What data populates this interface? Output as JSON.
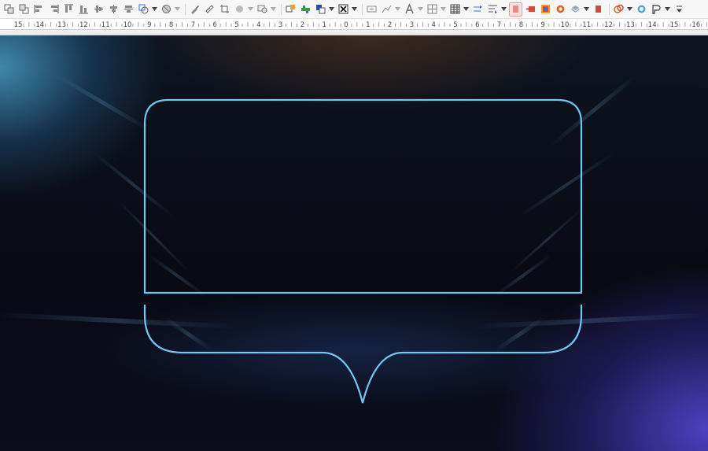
{
  "toolbar": {
    "icons": [
      "bring-forward-icon",
      "send-backward-icon",
      "align-left-icon",
      "align-right-icon",
      "align-top-icon",
      "align-bottom-icon",
      "align-center-horizontal-icon",
      "align-center-vertical-icon",
      "align-middle-icon",
      "shape-transform-icon",
      "shape-3d-icon",
      "brush-icon",
      "ruler-tool-icon",
      "crop-icon",
      "circle-icon",
      "object-icon",
      "flip-icon",
      "arrange-icon",
      "color-icon",
      "text-box-icon",
      "fontwork-icon",
      "connector-icon",
      "text-icon",
      "grid-icon",
      "table-icon",
      "line-arrow-icon",
      "chart-icon",
      "hyperlink-icon",
      "animation-icon",
      "image-icon",
      "media-icon",
      "layer-icon",
      "box-icon",
      "gallery-icon",
      "link-icon",
      "navigator-icon",
      "page-style-icon",
      "more-icon"
    ],
    "active_icon": "hyperlink-icon"
  },
  "ruler": {
    "labels": [
      "15",
      "14",
      "13",
      "12",
      "11",
      "10",
      "9",
      "8",
      "7",
      "6",
      "5",
      "4",
      "3",
      "2",
      "1",
      "0",
      "1",
      "2",
      "3",
      "4",
      "5",
      "6",
      "7",
      "8",
      "9",
      "10",
      "11",
      "12",
      "13",
      "14",
      "15",
      "16"
    ]
  },
  "slide": {
    "frame_color": "#6fc6f0",
    "background_colors": [
      "#0a0a14",
      "#4fb3dc",
      "#5646d2"
    ]
  }
}
